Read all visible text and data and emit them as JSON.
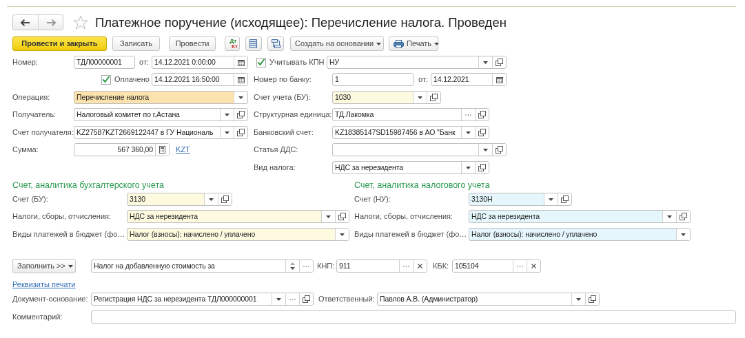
{
  "window": {
    "title": "Платежное поручение (исходящее): Перечисление налога. Проведен",
    "starred": false
  },
  "toolbar": [
    {
      "kind": "primary",
      "label": "Провести и закрыть"
    },
    {
      "kind": "button",
      "label": "Записать"
    },
    {
      "kind": "button",
      "label": "Провести"
    },
    {
      "kind": "postings",
      "lines": [
        "Дт",
        "Кт"
      ]
    },
    {
      "kind": "list"
    },
    {
      "kind": "structure"
    },
    {
      "kind": "menu",
      "label": "Создать на основании"
    },
    {
      "kind": "print",
      "label": "Печать"
    }
  ],
  "header_rows": [
    [
      {
        "kind": "label",
        "text": "Номер:"
      },
      {
        "kind": "field",
        "value": "ТДЛ00000001"
      },
      {
        "kind": "label",
        "text": "от:"
      },
      {
        "kind": "field",
        "value": "14.12.2021  0:00:00",
        "calendar": true
      },
      {
        "kind": "check",
        "label": "Учитывать КПН",
        "checked": true
      },
      {
        "kind": "field",
        "value": "НУ",
        "dropdown": true,
        "open": true
      }
    ],
    [
      {
        "kind": "check",
        "label": "Оплачено",
        "checked": true
      },
      {
        "kind": "field",
        "value": "14.12.2021 16:50:00",
        "calendar": true
      },
      {
        "kind": "label",
        "text": "Номер по банку:"
      },
      {
        "kind": "field",
        "value": "1"
      },
      {
        "kind": "label",
        "text": "от:"
      },
      {
        "kind": "field",
        "value": "14.12.2021",
        "calendar": true
      }
    ],
    [
      {
        "kind": "label",
        "text": "Операция:"
      },
      {
        "kind": "field",
        "value": "Перечисление налога",
        "dropdown": true,
        "color": "#fce3ad"
      },
      {
        "kind": "label",
        "text": "Счет учета (БУ):"
      },
      {
        "kind": "field",
        "value": "1030",
        "dropdown": true,
        "open": true,
        "color": "#fdfae0"
      }
    ],
    [
      {
        "kind": "label",
        "text": "Получатель:"
      },
      {
        "kind": "field",
        "value": "Налоговый комитет по г.Астана",
        "dropdown": true,
        "open": true
      },
      {
        "kind": "label",
        "text": "Структурная единица:"
      },
      {
        "kind": "field",
        "value": "ТД.Лакомка",
        "choose": true,
        "open": true
      }
    ],
    [
      {
        "kind": "label",
        "text": "Счет получателя:"
      },
      {
        "kind": "field",
        "value": "KZ27587KZT2669122447 в ГУ Националь",
        "dropdown": true,
        "open": true
      },
      {
        "kind": "label",
        "text": "Банковский счет:"
      },
      {
        "kind": "field",
        "value": "KZ18385147SD15987456 в АО \"Банк",
        "dropdown": true,
        "open": true
      }
    ],
    [
      {
        "kind": "label",
        "text": "Сумма:"
      },
      {
        "kind": "amount",
        "value": "567 360,00",
        "calc": true
      },
      {
        "kind": "link",
        "text": "KZT"
      },
      {
        "kind": "label",
        "text": "Статья ДДС:"
      },
      {
        "kind": "field",
        "dropdown": true,
        "open": true
      }
    ],
    [
      {
        "kind": "label",
        "text": "Вид налога:"
      },
      {
        "kind": "field",
        "value": "НДС за нерезидента",
        "dropdown": true,
        "open": true
      }
    ]
  ],
  "sections": [
    {
      "title": "Счет, аналитика бухгалтерского учета",
      "rows": [
        [
          {
            "kind": "label",
            "text": "Счет (БУ):"
          },
          {
            "kind": "field",
            "value": "3130",
            "dropdown": true,
            "open": true,
            "color": "#fdfae0"
          }
        ],
        [
          {
            "kind": "label",
            "text": "Налоги, сборы, отчисления:"
          },
          {
            "kind": "field",
            "value": "НДС за нерезидента",
            "dropdown": true,
            "open": true,
            "color": "#fdfae0"
          }
        ],
        [
          {
            "kind": "label",
            "text": "Виды платежей в бюджет (фо…"
          },
          {
            "kind": "field",
            "value": "Налог (взносы): начислено / уплачено",
            "dropdown": true,
            "color": "#fdfae0"
          }
        ]
      ]
    },
    {
      "title": "Счет, аналитика налогового учета",
      "rows": [
        [
          {
            "kind": "label",
            "text": "Счет (НУ):"
          },
          {
            "kind": "field",
            "value": "3130Н",
            "dropdown": true,
            "open": true,
            "color": "#e5f6fc"
          }
        ],
        [
          {
            "kind": "label",
            "text": "Налоги, сборы, отчисления:"
          },
          {
            "kind": "field",
            "value": "НДС за нерезидента",
            "dropdown": true,
            "open": true,
            "color": "#e5f6fc"
          }
        ],
        [
          {
            "kind": "label",
            "text": "Виды платежей в бюджет (фо…"
          },
          {
            "kind": "field",
            "value": "Налог (взносы): начислено / уплачено",
            "dropdown": true,
            "color": "#e5f6fc"
          }
        ]
      ]
    }
  ],
  "footer_rows": [
    [
      {
        "kind": "menu",
        "label": "Заполнить >>"
      },
      {
        "kind": "field",
        "value": "Налог на добавленную стоимость за",
        "spin": true,
        "choose": true
      },
      {
        "kind": "label",
        "text": "КНП:"
      },
      {
        "kind": "field",
        "value": "911",
        "choose": true,
        "clear": true
      },
      {
        "kind": "label",
        "text": "КБК:"
      },
      {
        "kind": "field",
        "value": "105104",
        "choose": true,
        "clear": true
      }
    ],
    [
      {
        "kind": "link",
        "text": "Реквизиты печати"
      }
    ],
    [
      {
        "kind": "label",
        "text": "Документ-основание:"
      },
      {
        "kind": "field",
        "value": "Регистрация НДС за нерезидента ТДЛ000000001",
        "dropdown": true,
        "choose": true,
        "open": true
      },
      {
        "kind": "label",
        "text": "Ответственный:"
      },
      {
        "kind": "field",
        "value": "Павлов А.В. (Администратор)",
        "dropdown": true,
        "open": true
      }
    ],
    [
      {
        "kind": "label",
        "text": "Комментарий:"
      },
      {
        "kind": "field"
      }
    ]
  ]
}
